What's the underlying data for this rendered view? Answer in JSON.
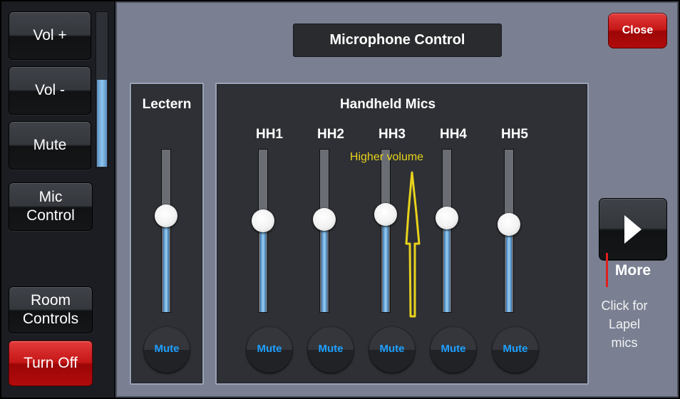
{
  "left_panel": {
    "vol_up": "Vol +",
    "vol_down": "Vol -",
    "mute": "Mute",
    "mic_control": "Mic Control",
    "room_controls": "Room Controls",
    "turn_off": "Turn Off",
    "volume_level": 0.56
  },
  "header": {
    "title": "Microphone Control",
    "close": "Close"
  },
  "lectern": {
    "title": "Lectern",
    "mute": "Mute",
    "level": 0.59
  },
  "handheld": {
    "title": "Handheld Mics",
    "channels": [
      {
        "label": "HH1",
        "mute": "Mute",
        "level": 0.56
      },
      {
        "label": "HH2",
        "mute": "Mute",
        "level": 0.57
      },
      {
        "label": "HH3",
        "mute": "Mute",
        "level": 0.6
      },
      {
        "label": "HH4",
        "mute": "Mute",
        "level": 0.58
      },
      {
        "label": "HH5",
        "mute": "Mute",
        "level": 0.54
      }
    ],
    "annotation": "Higher volume"
  },
  "more": {
    "label": "More",
    "note": "Click for Lapel mics"
  },
  "colors": {
    "accent_blue": "#1ea0ff",
    "annotation_yellow": "#e8d21c",
    "close_red": "#c51616",
    "marker_red": "#e01f1f"
  }
}
